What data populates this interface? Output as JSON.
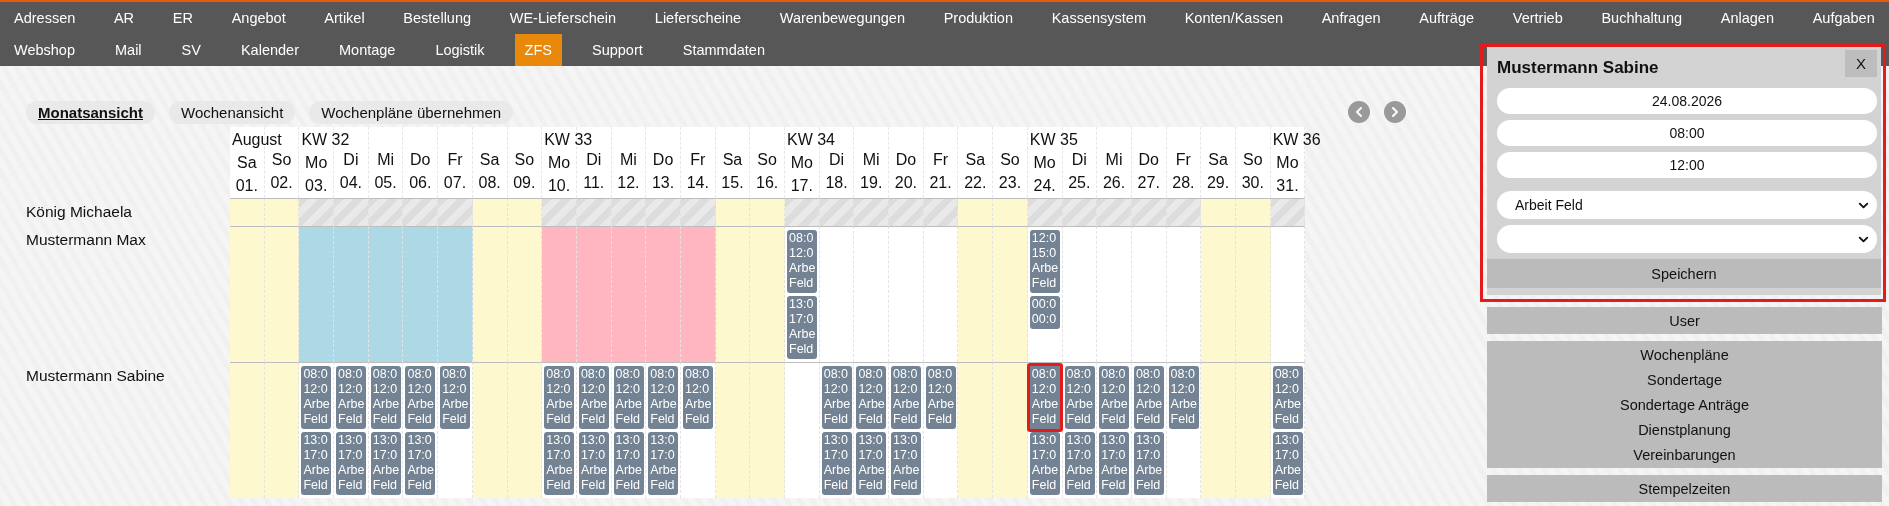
{
  "nav": {
    "primary": [
      {
        "label": "Adressen",
        "selected": false
      },
      {
        "label": "AR",
        "selected": false
      },
      {
        "label": "ER",
        "selected": false
      },
      {
        "label": "Angebot",
        "selected": false
      },
      {
        "label": "Artikel",
        "selected": false
      },
      {
        "label": "Bestellung",
        "selected": false
      },
      {
        "label": "WE-Lieferschein",
        "selected": false
      },
      {
        "label": "Lieferscheine",
        "selected": false
      },
      {
        "label": "Warenbewegungen",
        "selected": false
      },
      {
        "label": "Produktion",
        "selected": false
      },
      {
        "label": "Kassensystem",
        "selected": false
      },
      {
        "label": "Konten/Kassen",
        "selected": false
      },
      {
        "label": "Anfragen",
        "selected": false
      },
      {
        "label": "Aufträge",
        "selected": false
      },
      {
        "label": "Vertrieb",
        "selected": false
      },
      {
        "label": "Buchhaltung",
        "selected": false
      },
      {
        "label": "Anlagen",
        "selected": false
      },
      {
        "label": "Aufgaben",
        "selected": false
      }
    ],
    "secondary": [
      {
        "label": "Webshop",
        "selected": false
      },
      {
        "label": "Mail",
        "selected": false
      },
      {
        "label": "SV",
        "selected": false
      },
      {
        "label": "Kalender",
        "selected": false
      },
      {
        "label": "Montage",
        "selected": false
      },
      {
        "label": "Logistik",
        "selected": false
      },
      {
        "label": "ZFS",
        "selected": true
      },
      {
        "label": "Support",
        "selected": false
      },
      {
        "label": "Stammdaten",
        "selected": false
      }
    ]
  },
  "view_tabs": [
    {
      "label": "Monatsansicht",
      "selected": true
    },
    {
      "label": "Wochenansicht",
      "selected": false
    },
    {
      "label": "Wochenpläne übernehmen",
      "selected": false
    }
  ],
  "days": [
    {
      "week": "August",
      "weekday": "Sa",
      "date": "01."
    },
    {
      "weekday": "So",
      "date": "02."
    },
    {
      "week": "KW 32",
      "weekday": "Mo",
      "date": "03."
    },
    {
      "weekday": "Di",
      "date": "04."
    },
    {
      "weekday": "Mi",
      "date": "05."
    },
    {
      "weekday": "Do",
      "date": "06."
    },
    {
      "weekday": "Fr",
      "date": "07."
    },
    {
      "weekday": "Sa",
      "date": "08."
    },
    {
      "weekday": "So",
      "date": "09."
    },
    {
      "week": "KW 33",
      "weekday": "Mo",
      "date": "10."
    },
    {
      "weekday": "Di",
      "date": "11."
    },
    {
      "weekday": "Mi",
      "date": "12."
    },
    {
      "weekday": "Do",
      "date": "13."
    },
    {
      "weekday": "Fr",
      "date": "14."
    },
    {
      "weekday": "Sa",
      "date": "15."
    },
    {
      "weekday": "So",
      "date": "16."
    },
    {
      "week": "KW 34",
      "weekday": "Mo",
      "date": "17."
    },
    {
      "weekday": "Di",
      "date": "18."
    },
    {
      "weekday": "Mi",
      "date": "19."
    },
    {
      "weekday": "Do",
      "date": "20."
    },
    {
      "weekday": "Fr",
      "date": "21."
    },
    {
      "weekday": "Sa",
      "date": "22."
    },
    {
      "weekday": "So",
      "date": "23."
    },
    {
      "week": "KW 35",
      "weekday": "Mo",
      "date": "24."
    },
    {
      "weekday": "Di",
      "date": "25."
    },
    {
      "weekday": "Mi",
      "date": "26."
    },
    {
      "weekday": "Do",
      "date": "27."
    },
    {
      "weekday": "Fr",
      "date": "28."
    },
    {
      "weekday": "Sa",
      "date": "29."
    },
    {
      "weekday": "So",
      "date": "30."
    },
    {
      "week": "KW 36",
      "weekday": "Mo",
      "date": "31."
    }
  ],
  "rows": [
    {
      "name": "König Michaela",
      "cells": [
        {
          "color": "#fdf8cd",
          "hatched": false
        },
        {
          "color": "#fdf8cd",
          "hatched": false
        },
        {
          "color": "#dddddd",
          "hatched": true
        },
        {
          "color": "#dddddd",
          "hatched": true
        },
        {
          "color": "#dddddd",
          "hatched": true
        },
        {
          "color": "#dddddd",
          "hatched": true
        },
        {
          "color": "#dddddd",
          "hatched": true
        },
        {
          "color": "#fdf8cd",
          "hatched": false
        },
        {
          "color": "#fdf8cd",
          "hatched": false
        },
        {
          "color": "#dddddd",
          "hatched": true
        },
        {
          "color": "#dddddd",
          "hatched": true
        },
        {
          "color": "#dddddd",
          "hatched": true
        },
        {
          "color": "#dddddd",
          "hatched": true
        },
        {
          "color": "#dddddd",
          "hatched": true
        },
        {
          "color": "#fdf8cd",
          "hatched": false
        },
        {
          "color": "#fdf8cd",
          "hatched": false
        },
        {
          "color": "#dddddd",
          "hatched": true
        },
        {
          "color": "#dddddd",
          "hatched": true
        },
        {
          "color": "#dddddd",
          "hatched": true
        },
        {
          "color": "#dddddd",
          "hatched": true
        },
        {
          "color": "#dddddd",
          "hatched": true
        },
        {
          "color": "#fdf8cd",
          "hatched": false
        },
        {
          "color": "#fdf8cd",
          "hatched": false
        },
        {
          "color": "#dddddd",
          "hatched": true
        },
        {
          "color": "#dddddd",
          "hatched": true
        },
        {
          "color": "#dddddd",
          "hatched": true
        },
        {
          "color": "#dddddd",
          "hatched": true
        },
        {
          "color": "#dddddd",
          "hatched": true
        },
        {
          "color": "#fdf8cd",
          "hatched": false
        },
        {
          "color": "#fdf8cd",
          "hatched": false
        },
        {
          "color": "#dddddd",
          "hatched": true
        }
      ]
    },
    {
      "name": "Mustermann Max",
      "cells": [
        {
          "color": "#fdf8cd",
          "hatched": false
        },
        {
          "color": "#fdf8cd",
          "hatched": false
        },
        {
          "color": "#add8e6",
          "hatched": false
        },
        {
          "color": "#add8e6",
          "hatched": false
        },
        {
          "color": "#add8e6",
          "hatched": false
        },
        {
          "color": "#add8e6",
          "hatched": false
        },
        {
          "color": "#add8e6",
          "hatched": false
        },
        {
          "color": "#fdf8cd",
          "hatched": false
        },
        {
          "color": "#fdf8cd",
          "hatched": false
        },
        {
          "color": "#ffb6c1",
          "hatched": false
        },
        {
          "color": "#ffb6c1",
          "hatched": false
        },
        {
          "color": "#ffb6c1",
          "hatched": false
        },
        {
          "color": "#ffb6c1",
          "hatched": false
        },
        {
          "color": "#ffb6c1",
          "hatched": false
        },
        {
          "color": "#fdf8cd",
          "hatched": false
        },
        {
          "color": "#fdf8cd",
          "hatched": false
        },
        {
          "color": "#ffffff",
          "hatched": false,
          "entries": [
            {
              "lines": [
                "08:0",
                "12:0",
                "Arbe",
                "Feld"
              ],
              "selected": false
            },
            {
              "lines": [
                "13:0",
                "17:0",
                "Arbe",
                "Feld"
              ],
              "selected": false
            }
          ]
        },
        {
          "color": "#ffffff",
          "hatched": false
        },
        {
          "color": "#ffffff",
          "hatched": false
        },
        {
          "color": "#ffffff",
          "hatched": false
        },
        {
          "color": "#ffffff",
          "hatched": false
        },
        {
          "color": "#fdf8cd",
          "hatched": false
        },
        {
          "color": "#fdf8cd",
          "hatched": false
        },
        {
          "color": "#ffffff",
          "hatched": false,
          "entries": [
            {
              "lines": [
                "12:0",
                "15:0",
                "Arbe",
                "Feld"
              ],
              "selected": false
            },
            {
              "lines": [
                "00:0",
                "00:0"
              ],
              "selected": false
            }
          ]
        },
        {
          "color": "#ffffff",
          "hatched": false
        },
        {
          "color": "#ffffff",
          "hatched": false
        },
        {
          "color": "#ffffff",
          "hatched": false
        },
        {
          "color": "#ffffff",
          "hatched": false
        },
        {
          "color": "#fdf8cd",
          "hatched": false
        },
        {
          "color": "#fdf8cd",
          "hatched": false
        },
        {
          "color": "#ffffff",
          "hatched": false
        }
      ]
    },
    {
      "name": "Mustermann Sabine",
      "cells": [
        {
          "color": "#fdf8cd",
          "hatched": false
        },
        {
          "color": "#fdf8cd",
          "hatched": false
        },
        {
          "color": "#ffffff",
          "hatched": false,
          "entries": [
            {
              "lines": [
                "08:0",
                "12:0",
                "Arbe",
                "Feld"
              ],
              "selected": false
            },
            {
              "lines": [
                "13:0",
                "17:0",
                "Arbe",
                "Feld"
              ],
              "selected": false
            }
          ]
        },
        {
          "color": "#ffffff",
          "hatched": false,
          "entries": [
            {
              "lines": [
                "08:0",
                "12:0",
                "Arbe",
                "Feld"
              ],
              "selected": false
            },
            {
              "lines": [
                "13:0",
                "17:0",
                "Arbe",
                "Feld"
              ],
              "selected": false
            }
          ]
        },
        {
          "color": "#ffffff",
          "hatched": false,
          "entries": [
            {
              "lines": [
                "08:0",
                "12:0",
                "Arbe",
                "Feld"
              ],
              "selected": false
            },
            {
              "lines": [
                "13:0",
                "17:0",
                "Arbe",
                "Feld"
              ],
              "selected": false
            }
          ]
        },
        {
          "color": "#ffffff",
          "hatched": false,
          "entries": [
            {
              "lines": [
                "08:0",
                "12:0",
                "Arbe",
                "Feld"
              ],
              "selected": false
            },
            {
              "lines": [
                "13:0",
                "17:0",
                "Arbe",
                "Feld"
              ],
              "selected": false
            }
          ]
        },
        {
          "color": "#ffffff",
          "hatched": false,
          "entries": [
            {
              "lines": [
                "08:0",
                "12:0",
                "Arbe",
                "Feld"
              ],
              "selected": false
            }
          ]
        },
        {
          "color": "#fdf8cd",
          "hatched": false
        },
        {
          "color": "#fdf8cd",
          "hatched": false
        },
        {
          "color": "#ffffff",
          "hatched": false,
          "entries": [
            {
              "lines": [
                "08:0",
                "12:0",
                "Arbe",
                "Feld"
              ],
              "selected": false
            },
            {
              "lines": [
                "13:0",
                "17:0",
                "Arbe",
                "Feld"
              ],
              "selected": false
            }
          ]
        },
        {
          "color": "#ffffff",
          "hatched": false,
          "entries": [
            {
              "lines": [
                "08:0",
                "12:0",
                "Arbe",
                "Feld"
              ],
              "selected": false
            },
            {
              "lines": [
                "13:0",
                "17:0",
                "Arbe",
                "Feld"
              ],
              "selected": false
            }
          ]
        },
        {
          "color": "#ffffff",
          "hatched": false,
          "entries": [
            {
              "lines": [
                "08:0",
                "12:0",
                "Arbe",
                "Feld"
              ],
              "selected": false
            },
            {
              "lines": [
                "13:0",
                "17:0",
                "Arbe",
                "Feld"
              ],
              "selected": false
            }
          ]
        },
        {
          "color": "#ffffff",
          "hatched": false,
          "entries": [
            {
              "lines": [
                "08:0",
                "12:0",
                "Arbe",
                "Feld"
              ],
              "selected": false
            },
            {
              "lines": [
                "13:0",
                "17:0",
                "Arbe",
                "Feld"
              ],
              "selected": false
            }
          ]
        },
        {
          "color": "#ffffff",
          "hatched": false,
          "entries": [
            {
              "lines": [
                "08:0",
                "12:0",
                "Arbe",
                "Feld"
              ],
              "selected": false
            }
          ]
        },
        {
          "color": "#fdf8cd",
          "hatched": false
        },
        {
          "color": "#fdf8cd",
          "hatched": false
        },
        {
          "color": "#ffffff",
          "hatched": false
        },
        {
          "color": "#ffffff",
          "hatched": false,
          "entries": [
            {
              "lines": [
                "08:0",
                "12:0",
                "Arbe",
                "Feld"
              ],
              "selected": false
            },
            {
              "lines": [
                "13:0",
                "17:0",
                "Arbe",
                "Feld"
              ],
              "selected": false
            }
          ]
        },
        {
          "color": "#ffffff",
          "hatched": false,
          "entries": [
            {
              "lines": [
                "08:0",
                "12:0",
                "Arbe",
                "Feld"
              ],
              "selected": false
            },
            {
              "lines": [
                "13:0",
                "17:0",
                "Arbe",
                "Feld"
              ],
              "selected": false
            }
          ]
        },
        {
          "color": "#ffffff",
          "hatched": false,
          "entries": [
            {
              "lines": [
                "08:0",
                "12:0",
                "Arbe",
                "Feld"
              ],
              "selected": false
            },
            {
              "lines": [
                "13:0",
                "17:0",
                "Arbe",
                "Feld"
              ],
              "selected": false
            }
          ]
        },
        {
          "color": "#ffffff",
          "hatched": false,
          "entries": [
            {
              "lines": [
                "08:0",
                "12:0",
                "Arbe",
                "Feld"
              ],
              "selected": false
            }
          ]
        },
        {
          "color": "#fdf8cd",
          "hatched": false
        },
        {
          "color": "#fdf8cd",
          "hatched": false
        },
        {
          "color": "#ffffff",
          "hatched": false,
          "entries": [
            {
              "lines": [
                "08:0",
                "12:0",
                "Arbe",
                "Feld"
              ],
              "selected": true
            },
            {
              "lines": [
                "13:0",
                "17:0",
                "Arbe",
                "Feld"
              ],
              "selected": false
            }
          ]
        },
        {
          "color": "#ffffff",
          "hatched": false,
          "entries": [
            {
              "lines": [
                "08:0",
                "12:0",
                "Arbe",
                "Feld"
              ],
              "selected": false
            },
            {
              "lines": [
                "13:0",
                "17:0",
                "Arbe",
                "Feld"
              ],
              "selected": false
            }
          ]
        },
        {
          "color": "#ffffff",
          "hatched": false,
          "entries": [
            {
              "lines": [
                "08:0",
                "12:0",
                "Arbe",
                "Feld"
              ],
              "selected": false
            },
            {
              "lines": [
                "13:0",
                "17:0",
                "Arbe",
                "Feld"
              ],
              "selected": false
            }
          ]
        },
        {
          "color": "#ffffff",
          "hatched": false,
          "entries": [
            {
              "lines": [
                "08:0",
                "12:0",
                "Arbe",
                "Feld"
              ],
              "selected": false
            },
            {
              "lines": [
                "13:0",
                "17:0",
                "Arbe",
                "Feld"
              ],
              "selected": false
            }
          ]
        },
        {
          "color": "#ffffff",
          "hatched": false,
          "entries": [
            {
              "lines": [
                "08:0",
                "12:0",
                "Arbe",
                "Feld"
              ],
              "selected": false
            }
          ]
        },
        {
          "color": "#fdf8cd",
          "hatched": false
        },
        {
          "color": "#fdf8cd",
          "hatched": false
        },
        {
          "color": "#ffffff",
          "hatched": false,
          "entries": [
            {
              "lines": [
                "08:0",
                "12:0",
                "Arbe",
                "Feld"
              ],
              "selected": false
            },
            {
              "lines": [
                "13:0",
                "17:0",
                "Arbe",
                "Feld"
              ],
              "selected": false
            }
          ]
        }
      ]
    }
  ],
  "popup": {
    "title": "Mustermann Sabine",
    "close": "X",
    "fields": [
      {
        "kind": "text",
        "value": "24.08.2026"
      },
      {
        "kind": "text",
        "value": "08:00"
      },
      {
        "kind": "text",
        "value": "12:00"
      },
      {
        "kind": "select",
        "value": "Arbeit Feld"
      },
      {
        "kind": "select"
      }
    ],
    "save": "Speichern"
  },
  "side_menu": [
    {
      "items": [
        "User"
      ]
    },
    {
      "items": [
        "Wochenpläne",
        "Sondertage",
        "Sondertage Anträge",
        "Dienstplanung",
        "Vereinbarungen"
      ]
    },
    {
      "items": [
        "Stempelzeiten"
      ]
    }
  ]
}
